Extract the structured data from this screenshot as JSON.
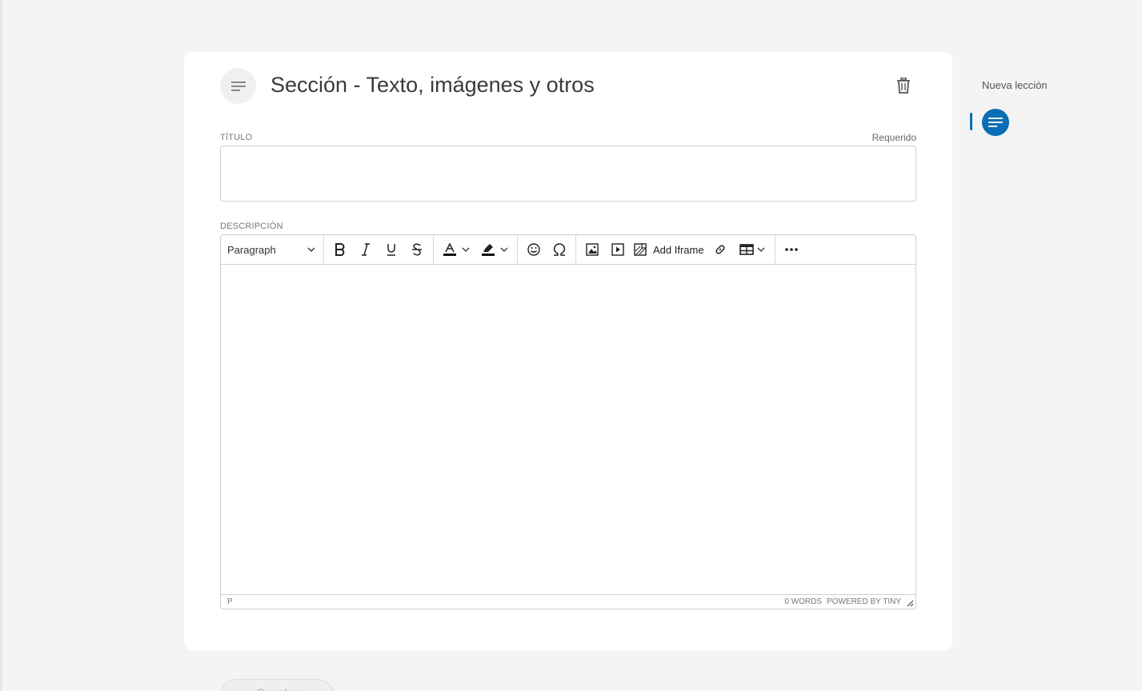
{
  "section": {
    "title": "Sección - Texto, imágenes y otros",
    "icon": "text-lines-icon",
    "delete_icon": "trash-icon"
  },
  "form": {
    "title_label": "TÍTULO",
    "title_required": "Requerido",
    "title_value": "",
    "description_label": "DESCRIPCIÓN"
  },
  "editor": {
    "format_select": "Paragraph",
    "toolbar": {
      "bold": "bold-icon",
      "italic": "italic-icon",
      "underline": "underline-icon",
      "strikethrough": "strikethrough-icon",
      "text_color": "text-color-icon",
      "highlight": "highlight-icon",
      "emoji": "emoji-icon",
      "special_char": "omega-icon",
      "image": "image-icon",
      "media": "media-icon",
      "add_iframe": "Add Iframe",
      "link": "link-icon",
      "table": "table-icon",
      "more": "more-icon"
    },
    "status_path": "P",
    "word_count": "0 WORDS",
    "powered_by": "POWERED BY TINY"
  },
  "sidebar": {
    "new_lesson_label": "Nueva lección",
    "lesson_icon": "text-lines-icon"
  },
  "footer": {
    "save_label": "Guardar"
  },
  "colors": {
    "accent": "#0a6fb4",
    "background": "#f4f4f4",
    "card": "#ffffff"
  }
}
